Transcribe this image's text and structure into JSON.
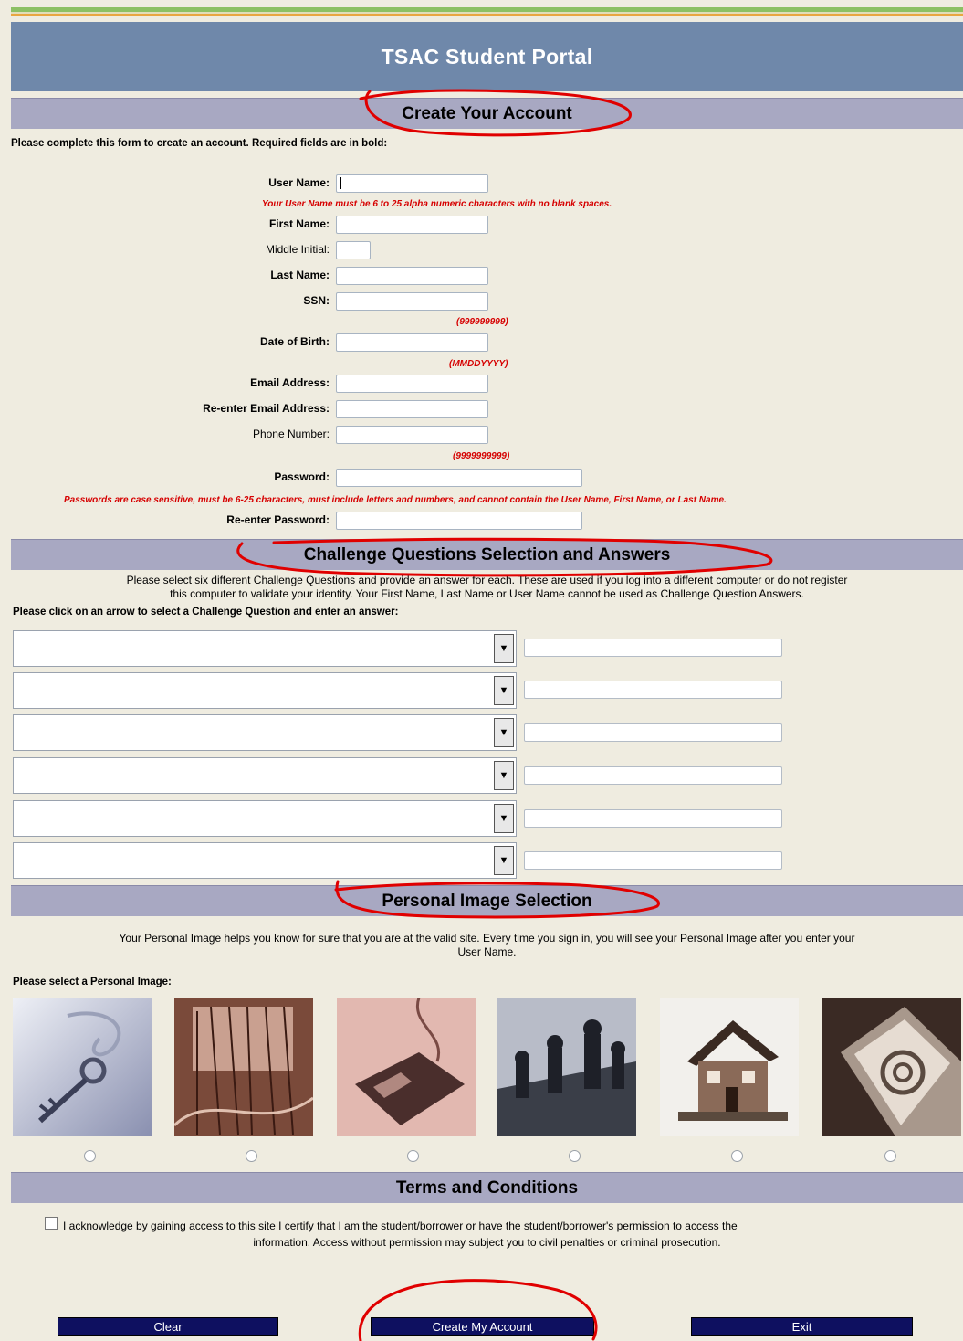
{
  "header": {
    "title": "TSAC Student Portal"
  },
  "account": {
    "section_title": "Create Your Account",
    "intro": "Please complete this form to create an account.  Required fields are in bold:",
    "fields": {
      "username": {
        "label": "User Name:",
        "value": ""
      },
      "first_name": {
        "label": "First Name:",
        "value": ""
      },
      "middle_initial": {
        "label": "Middle Initial:",
        "value": ""
      },
      "last_name": {
        "label": "Last Name:",
        "value": ""
      },
      "ssn": {
        "label": "SSN:",
        "value": ""
      },
      "dob": {
        "label": "Date of Birth:",
        "value": ""
      },
      "email": {
        "label": "Email Address:",
        "value": ""
      },
      "email_confirm": {
        "label": "Re-enter Email Address:",
        "value": ""
      },
      "phone": {
        "label": "Phone Number:",
        "value": ""
      },
      "password": {
        "label": "Password:",
        "value": ""
      },
      "password_confirm": {
        "label": "Re-enter Password:",
        "value": ""
      }
    },
    "notes": {
      "username": "Your User Name must be 6 to 25 alpha numeric characters with no blank spaces.",
      "ssn_format": "(999999999)",
      "dob_format": "(MMDDYYYY)",
      "phone_format": "(9999999999)",
      "password": "Passwords are case sensitive, must be 6-25 characters, must include letters and numbers, and cannot contain the User Name, First Name, or Last Name."
    }
  },
  "challenge": {
    "section_title": "Challenge Questions Selection and Answers",
    "intro_line1": "Please select six different Challenge Questions and provide an answer for each. These are used if you log into a different computer or do not register",
    "intro_line2": "this computer to validate your identity. Your First Name, Last Name or User Name cannot be used as Challenge Question Answers.",
    "prompt": "Please click on an arrow to select a Challenge Question and enter an answer:",
    "arrow_glyph": "▼"
  },
  "personal_image": {
    "section_title": "Personal Image Selection",
    "intro_line1": "Your Personal Image helps you know for sure that you are at the valid site. Every time you sign in, you will see your Personal Image after you enter your",
    "intro_line2": "User Name.",
    "prompt": "Please select a Personal Image:",
    "images": [
      "key-image",
      "wires-image",
      "mouse-image",
      "chess-image",
      "house-image",
      "email-at-image"
    ]
  },
  "terms": {
    "section_title": "Terms and Conditions",
    "line1": "I acknowledge by gaining access to this site I certify that I am the student/borrower or have the student/borrower's permission to access the",
    "line2": "information. Access without permission may subject you to civil penalties or criminal prosecution."
  },
  "buttons": {
    "clear": "Clear",
    "create": "Create My Account",
    "exit": "Exit"
  },
  "colors": {
    "header_bg": "#6f88aa",
    "section_bg": "#a8a8c2",
    "page_bg": "#efece0",
    "note_red": "#d60000",
    "button_bg": "#0e1060",
    "annotation_red": "#e00000"
  }
}
